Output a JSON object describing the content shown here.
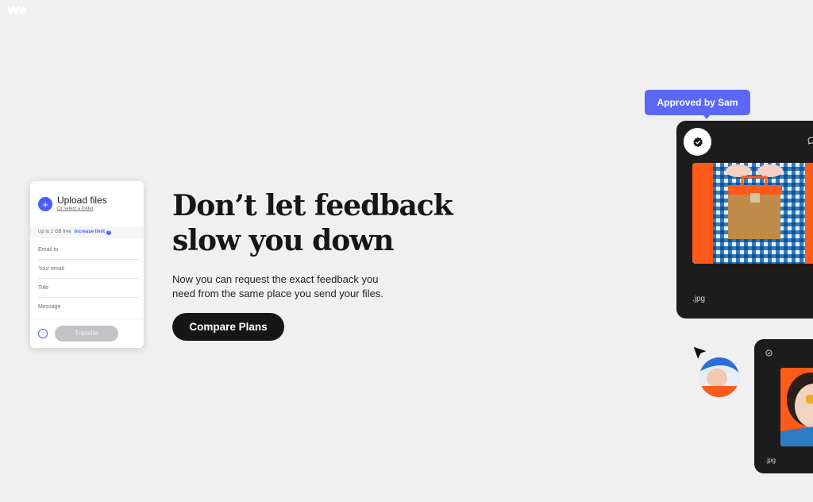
{
  "brand": {
    "logo_text": "we"
  },
  "upload_panel": {
    "title": "Upload files",
    "select_folder": "Or select a folder",
    "limit_text": "Up to 2 GB free",
    "increase_limit": "Increase limit",
    "info_glyph": "?",
    "fields": [
      {
        "name": "email-to",
        "placeholder": "Email to"
      },
      {
        "name": "your-email",
        "placeholder": "Your email"
      },
      {
        "name": "title",
        "placeholder": "Title"
      },
      {
        "name": "message",
        "placeholder": "Message"
      }
    ],
    "more_glyph": "···",
    "transfer_label": "Transfer"
  },
  "hero": {
    "title_line1": "Don’t let feedback",
    "title_line2": "slow you down",
    "subtitle_line1": "Now you can request the exact feedback you",
    "subtitle_line2": "need from the same place you send your files.",
    "cta_label": "Compare Plans"
  },
  "cards": {
    "approved_label": "Approved by Sam",
    "card1_ext": ".jpg",
    "card2_ext": ".jpg"
  },
  "colors": {
    "accent": "#4b5eff",
    "approved_bg": "#5a68f5",
    "card_bg": "#1c1c1c",
    "photo_bg": "#ff5a1a",
    "page_bg": "#f0f0f0"
  }
}
